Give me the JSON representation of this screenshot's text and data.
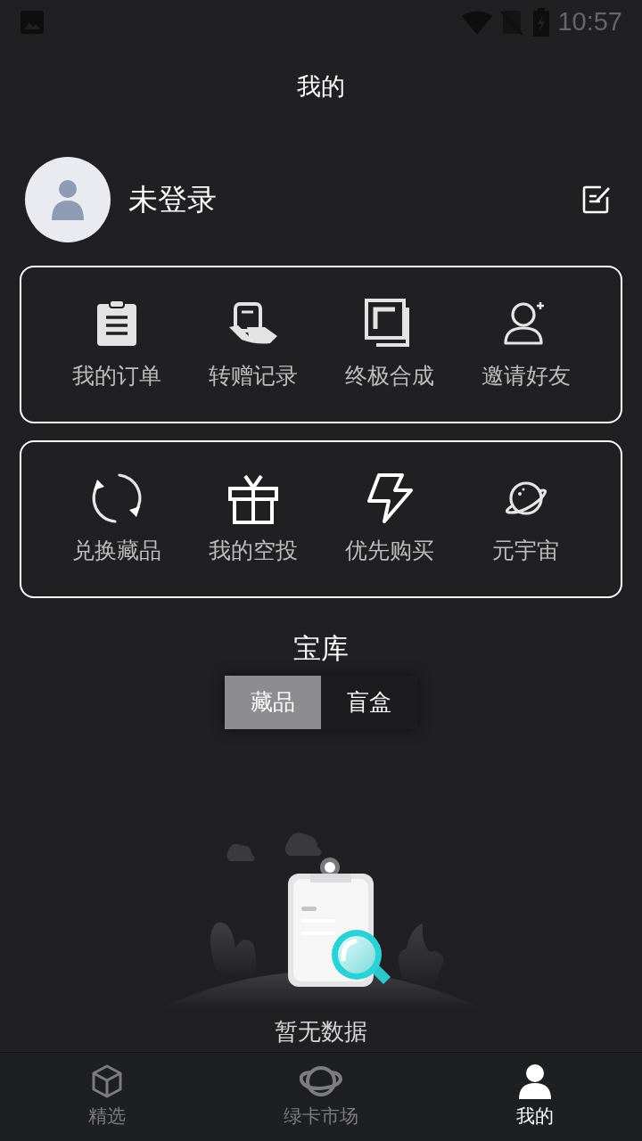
{
  "status_bar": {
    "time": "10:57"
  },
  "title": "我的",
  "profile": {
    "name": "未登录"
  },
  "menu_cards": [
    {
      "items": [
        {
          "label": "我的订单"
        },
        {
          "label": "转赠记录"
        },
        {
          "label": "终极合成"
        },
        {
          "label": "邀请好友"
        }
      ]
    },
    {
      "items": [
        {
          "label": "兑换藏品"
        },
        {
          "label": "我的空投"
        },
        {
          "label": "优先购买"
        },
        {
          "label": "元宇宙"
        }
      ]
    }
  ],
  "vault": {
    "title": "宝库",
    "tabs": [
      {
        "label": "藏品",
        "selected": true
      },
      {
        "label": "盲盒",
        "selected": false
      }
    ]
  },
  "empty_state": {
    "message": "暂无数据"
  },
  "bottom_nav": [
    {
      "label": "精选",
      "selected": false
    },
    {
      "label": "绿卡市场",
      "selected": false
    },
    {
      "label": "我的",
      "selected": true
    }
  ]
}
